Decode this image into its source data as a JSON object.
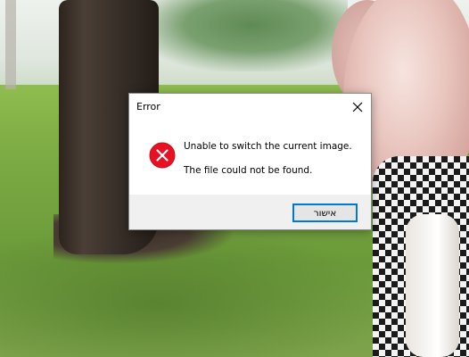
{
  "dialog": {
    "title": "Error",
    "message_line1": "Unable to switch the current image.",
    "message_line2": "The file could not be found.",
    "ok_label": "אישור",
    "icon": "error-icon",
    "close_icon": "close-icon"
  },
  "colors": {
    "error_red": "#e81123",
    "button_focus_border": "#0078d7",
    "footer_bg": "#f0f0f0"
  }
}
